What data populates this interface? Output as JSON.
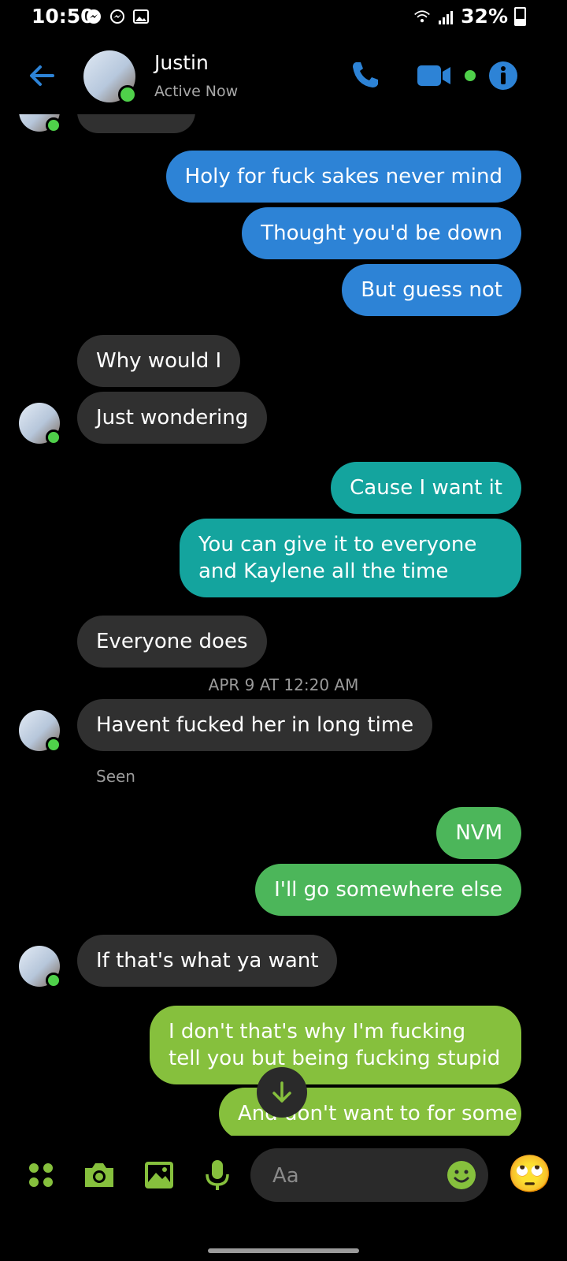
{
  "status_bar": {
    "time": "10:50",
    "battery": "32%",
    "battery_level": 0.32,
    "icons": [
      "messenger-icon",
      "messenger-icon",
      "gallery-icon",
      "wifi-icon",
      "signal-icon",
      "battery-icon"
    ]
  },
  "header": {
    "contact_name": "Justin",
    "contact_status": "Active Now",
    "icons": [
      "back-arrow-icon",
      "phone-icon",
      "video-icon",
      "info-icon"
    ],
    "accent": "#2d83d6",
    "online_color": "#4fd04a"
  },
  "thread": {
    "messages": [
      {
        "dir": "out",
        "text": "Holy for fuck sakes never mind"
      },
      {
        "dir": "out",
        "text": "Thought you'd be down"
      },
      {
        "dir": "out",
        "text": "But guess not"
      },
      {
        "dir": "in",
        "text": "Why would I"
      },
      {
        "dir": "in",
        "text": "Just wondering"
      },
      {
        "dir": "out",
        "text": "Cause I want it"
      },
      {
        "dir": "out",
        "text": "You can give it to everyone and Kaylene all the time"
      },
      {
        "dir": "in",
        "text": "Everyone  does"
      },
      {
        "dir": "in",
        "text": "Havent  fucked her in long time"
      },
      {
        "dir": "out",
        "text": "NVM"
      },
      {
        "dir": "out",
        "text": "I'll go somewhere else"
      },
      {
        "dir": "in",
        "text": "If that's what ya want"
      },
      {
        "dir": "out",
        "text": "I don't that's why I'm fucking tell you but being fucking stupid"
      },
      {
        "dir": "out",
        "text": "And don't want to for some"
      }
    ],
    "timestamp": "APR 9 AT 12:20 AM",
    "seen_label": "Seen",
    "bubble_colors": [
      "#2d83d6",
      "#14a49e",
      "#4cb65a",
      "#86c03d"
    ],
    "incoming_color": "#303030"
  },
  "composer": {
    "placeholder": "Aa",
    "icons": [
      "apps-icon",
      "camera-icon",
      "image-icon",
      "microphone-icon",
      "emoji-icon"
    ],
    "quick_reaction": "🙄",
    "icon_color": "#86c03d"
  }
}
